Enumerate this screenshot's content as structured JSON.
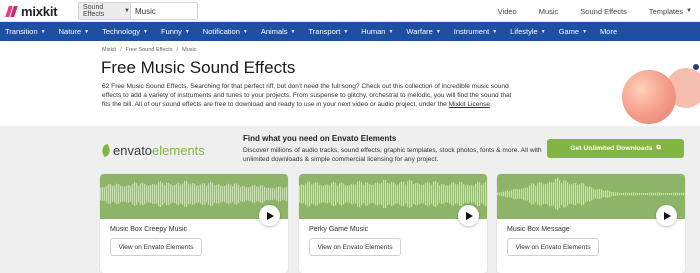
{
  "header": {
    "logo_text": "mixkit",
    "search": {
      "category_label": "Sound Effects",
      "value": "Music"
    },
    "nav": [
      {
        "label": "Video",
        "dropdown": false
      },
      {
        "label": "Music",
        "dropdown": false
      },
      {
        "label": "Sound Effects",
        "dropdown": false
      },
      {
        "label": "Templates",
        "dropdown": true
      }
    ]
  },
  "categories": [
    "Transition",
    "Nature",
    "Technology",
    "Funny",
    "Notification",
    "Animals",
    "Transport",
    "Human",
    "Warfare",
    "Instrument",
    "Lifestyle",
    "Game",
    "More"
  ],
  "breadcrumb": [
    "Mixkit",
    "/",
    "Free Sound Effects",
    "/",
    "Music"
  ],
  "hero": {
    "title": "Free Music Sound Effects",
    "intro_text": "62 Free Music Sound Effects. Searching for that perfect riff, but don't need the full song? Check out this collection of incredible music sound effects to add a variety of instruments and tunes to your projects. From suspense to glitchy, orchestral to melodic, you will find the sound that fits the bill. All of our sound effects are free to download and ready to use in your next video or audio project, under the ",
    "license_link": "Mixkit License",
    "intro_end": "."
  },
  "envato": {
    "logo_part1": "envato",
    "logo_part2": "elements",
    "title": "Find what you need on Envato Elements",
    "text": "Discover millions of audio tracks, sound effects, graphic templates, stock photos, fonts & more. All with unlimited downloads & simple commercial licensing for any project.",
    "cta_label": "Get Unlimited Downloads"
  },
  "cards": [
    {
      "title": "Music Box Creepy Music",
      "button": "View on Envato Elements"
    },
    {
      "title": "Perky Game Music",
      "button": "View on Envato Elements"
    },
    {
      "title": "Music Box Message",
      "button": "View on Envato Elements"
    }
  ],
  "colors": {
    "brand_blue": "#1e4fa3",
    "envato_green": "#82b541",
    "waveform_bg": "#8eb567",
    "logo_pink": "#e83e7a"
  }
}
